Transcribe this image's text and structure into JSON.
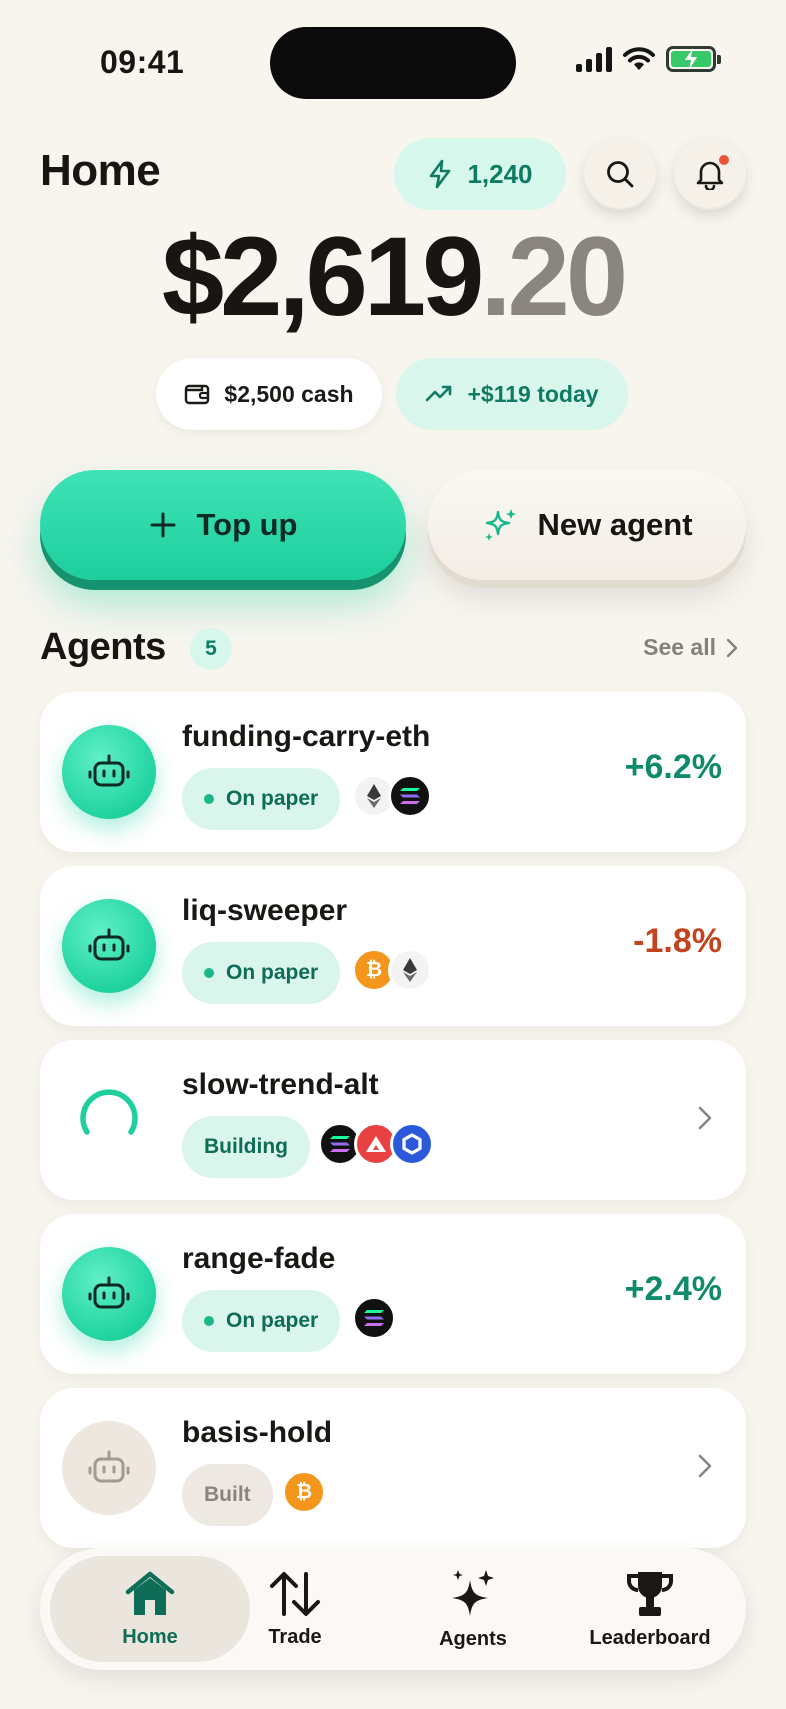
{
  "status_bar": {
    "time": "09:41"
  },
  "header": {
    "title": "Home",
    "points": "1,240"
  },
  "balance": {
    "whole": "$2,619",
    "cents": ".20"
  },
  "summary": {
    "cash": "$2,500 cash",
    "today": "+$119 today"
  },
  "actions": {
    "top_up": "Top up",
    "new_agent": "New agent"
  },
  "agents_section": {
    "title": "Agents",
    "count": "5",
    "see_all": "See all"
  },
  "agents": [
    {
      "name": "funding-carry-eth",
      "status": "On paper",
      "coins": [
        "ETH",
        "SOL"
      ],
      "change": "+6.2%"
    },
    {
      "name": "liq-sweeper",
      "status": "On paper",
      "coins": [
        "BTC",
        "ETH"
      ],
      "change": "-1.8%"
    },
    {
      "name": "slow-trend-alt",
      "status": "Building",
      "coins": [
        "SOL",
        "AVAX",
        "LINK"
      ],
      "change": ""
    },
    {
      "name": "range-fade",
      "status": "On paper",
      "coins": [
        "SOL"
      ],
      "change": "+2.4%"
    },
    {
      "name": "basis-hold",
      "status": "Built",
      "coins": [
        "BTC"
      ],
      "change": ""
    }
  ],
  "nav": {
    "home": "Home",
    "trade": "Trade",
    "agents": "Agents",
    "leaderboard": "Leaderboard"
  },
  "colors": {
    "accent": "#1dcf9d",
    "positive": "#0f8a6a",
    "negative": "#c2441f",
    "background": "#f8f5ef"
  }
}
